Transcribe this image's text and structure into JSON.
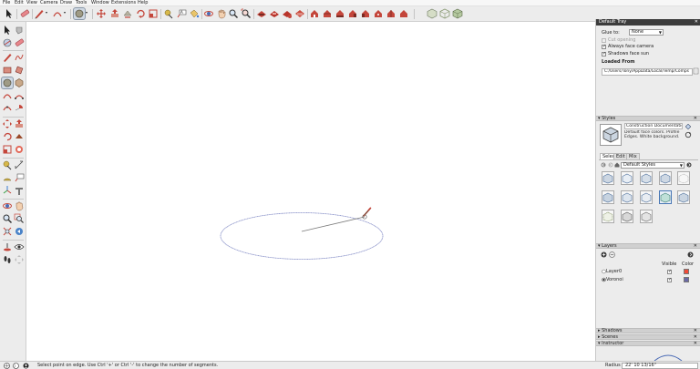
{
  "menu": [
    "File",
    "Edit",
    "View",
    "Camera",
    "Draw",
    "Tools",
    "Window",
    "Extensions",
    "Help"
  ],
  "status": {
    "hint": "Select point on edge. Use Ctrl '+' or Ctrl '-' to change the number of segments.",
    "vcb_label": "Radius",
    "vcb_value": "22' 10 13/16\""
  },
  "tray": {
    "title": "Default Tray",
    "entity_info": {
      "glue_to_label": "Glue to:",
      "glue_to_value": "None",
      "cut_opening": "Cut opening",
      "always_face_camera": "Always face camera",
      "shadows_face_sun": "Shadows face sun",
      "loaded_from_label": "Loaded From",
      "loaded_from_value": "C:/Users/Tony/AppData/Local/Temp/Comps"
    },
    "styles": {
      "header": "Styles",
      "style_name": "Construction Documentation Sty",
      "style_desc": "Default face colors. Profile Edges. White background.",
      "tabs": [
        "Select",
        "Edit",
        "Mix"
      ],
      "library": "Default Styles"
    },
    "layers": {
      "header": "Layers",
      "col_visible": "Visible",
      "col_color": "Color",
      "rows": [
        {
          "name": "Layer0",
          "color": "#f04a37"
        },
        {
          "name": "Voronoi",
          "color": "#6a69a6"
        }
      ]
    },
    "collapsed_panels": [
      "Shadows",
      "Scenes",
      "Instructor"
    ]
  },
  "colors": {
    "selection_blue": "#8890c8",
    "tool_accent": "#b44a3c"
  }
}
